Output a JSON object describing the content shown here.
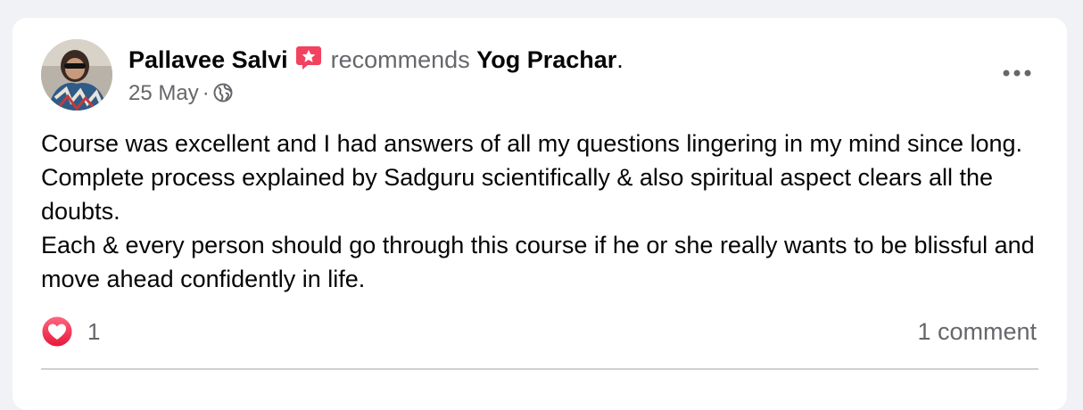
{
  "post": {
    "author": "Pallavee Salvi",
    "action": "recommends",
    "page": "Yog Prachar",
    "period": ".",
    "date": "25 May",
    "separator": "·",
    "paragraphs": [
      "Course was excellent and I had answers of all my questions lingering in my mind since long. Complete process explained by Sadguru scientifically & also spiritual aspect clears all the doubts.",
      "Each & every person should go through this course if he or she really wants to be blissful and move ahead confidently in life."
    ],
    "reaction_count": "1",
    "comment_count_label": "1 comment",
    "icons": {
      "badge": "recommendation-star-icon",
      "privacy": "globe-icon",
      "menu": "more-options-icon",
      "reaction": "love-heart-icon"
    },
    "colors": {
      "background": "#f0f2f5",
      "card": "#ffffff",
      "primary_text": "#050505",
      "secondary_text": "#65676b",
      "recommend_badge": "#f3425f",
      "love_reaction": "#f33e58"
    }
  }
}
